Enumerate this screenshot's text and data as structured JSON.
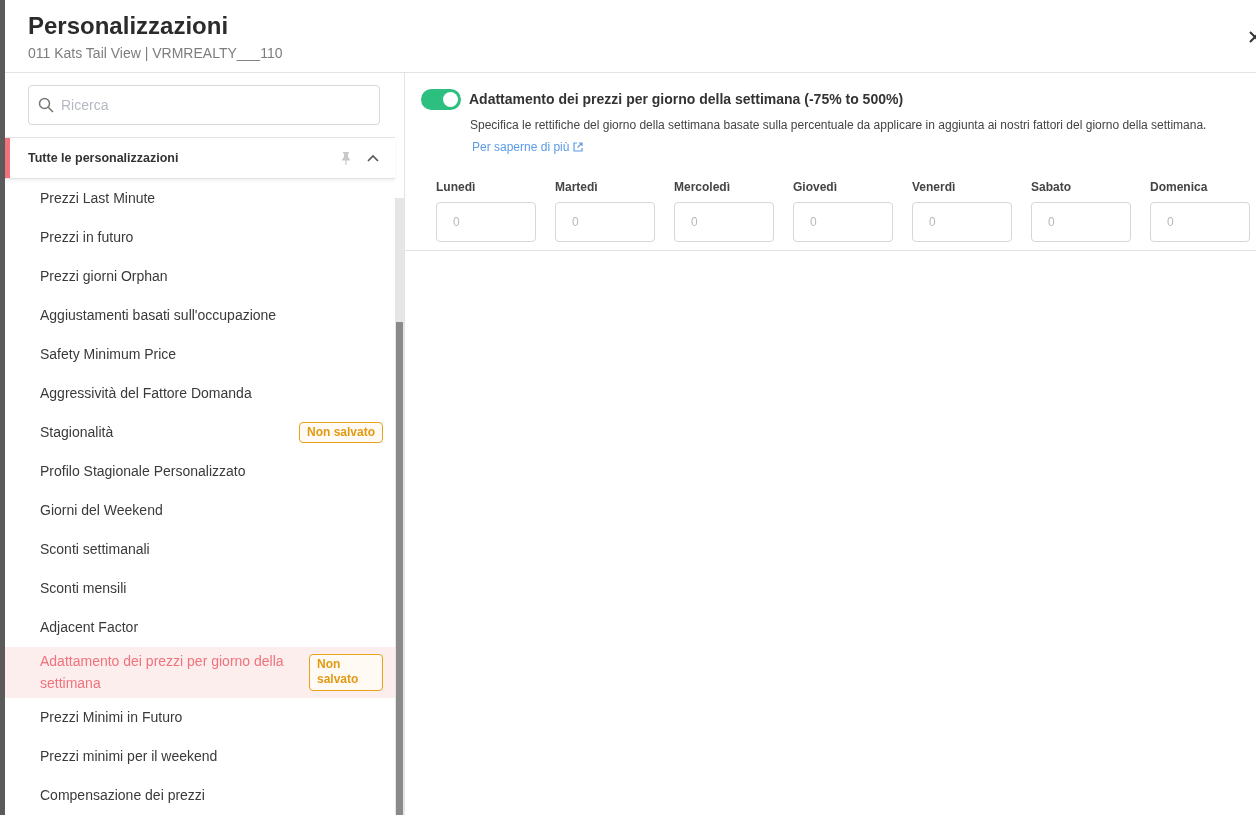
{
  "header": {
    "title": "Personalizzazioni",
    "subtitle": "011 Kats Tail View | VRMREALTY___110"
  },
  "sidebar": {
    "search": {
      "placeholder": "Ricerca"
    },
    "group": {
      "label": "Tutte le personalizzazioni",
      "expanded": true
    },
    "items": [
      {
        "label": "Prezzi Last Minute",
        "selected": false
      },
      {
        "label": "Prezzi in futuro",
        "selected": false
      },
      {
        "label": "Prezzi giorni Orphan",
        "selected": false
      },
      {
        "label": "Aggiustamenti basati sull'occupazione",
        "selected": false
      },
      {
        "label": "Safety Minimum Price",
        "selected": false
      },
      {
        "label": "Aggressività del Fattore Domanda",
        "selected": false
      },
      {
        "label": "Stagionalità",
        "selected": false,
        "badge": "Non salvato"
      },
      {
        "label": "Profilo Stagionale Personalizzato",
        "selected": false
      },
      {
        "label": "Giorni del Weekend",
        "selected": false
      },
      {
        "label": "Sconti settimanali",
        "selected": false
      },
      {
        "label": "Sconti mensili",
        "selected": false
      },
      {
        "label": "Adjacent Factor",
        "selected": false
      },
      {
        "label": "Adattamento dei prezzi per giorno della settimana",
        "selected": true,
        "badge": "Non salvato"
      },
      {
        "label": "Prezzi Minimi in Futuro",
        "selected": false
      },
      {
        "label": "Prezzi minimi per il weekend",
        "selected": false
      },
      {
        "label": "Compensazione dei prezzi",
        "selected": false
      }
    ]
  },
  "panel": {
    "toggle": {
      "on": true
    },
    "title": "Adattamento dei prezzi per giorno della settimana (-75% to 500%)",
    "description": "Specifica le rettifiche del giorno della settimana basate sulla percentuale da applicare in aggiunta ai nostri fattori del giorno della settimana.",
    "link": "Per saperne di più",
    "days": [
      {
        "label": "Lunedì",
        "placeholder": "0"
      },
      {
        "label": "Martedì",
        "placeholder": "0"
      },
      {
        "label": "Mercoledì",
        "placeholder": "0"
      },
      {
        "label": "Giovedì",
        "placeholder": "0"
      },
      {
        "label": "Venerdì",
        "placeholder": "0"
      },
      {
        "label": "Sabato",
        "placeholder": "0"
      },
      {
        "label": "Domenica",
        "placeholder": "0"
      }
    ]
  }
}
